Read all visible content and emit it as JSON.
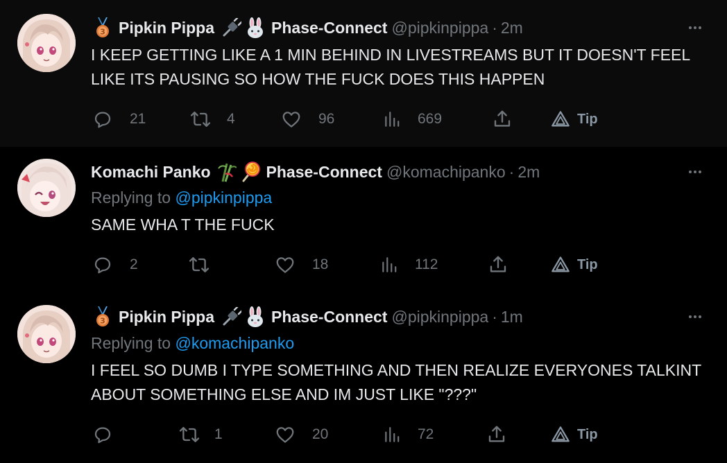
{
  "tweets": [
    {
      "name": "Pipkin Pippa",
      "affiliation": "Phase-Connect",
      "handle": "@pipkinpippa",
      "dot": "·",
      "time": "2m",
      "replying_label": "",
      "replying_to": "",
      "text": "I KEEP GETTING LIKE A 1 MIN BEHIND IN LIVESTREAMS BUT IT DOESN'T FEEL LIKE ITS PAUSING SO HOW THE FUCK DOES THIS HAPPEN",
      "replies": "21",
      "retweets": "4",
      "likes": "96",
      "views": "669",
      "tip": "Tip",
      "badge_icons": [
        "medal-icon",
        "plug-icon",
        "rabbit-icon"
      ]
    },
    {
      "name": "Komachi Panko",
      "affiliation": "Phase-Connect",
      "handle": "@komachipanko",
      "dot": "·",
      "time": "2m",
      "replying_label": "Replying to",
      "replying_to": "@pipkinpippa",
      "text": "SAME WHA T THE FUCK",
      "replies": "2",
      "retweets": "",
      "likes": "18",
      "views": "112",
      "tip": "Tip",
      "badge_icons": [
        "bamboo-icon",
        "lollipop-icon"
      ]
    },
    {
      "name": "Pipkin Pippa",
      "affiliation": "Phase-Connect",
      "handle": "@pipkinpippa",
      "dot": "·",
      "time": "1m",
      "replying_label": "Replying to",
      "replying_to": "@komachipanko",
      "text": "I FEEL SO DUMB I TYPE SOMETHING AND THEN REALIZE EVERYONES TALKINT ABOUT SOMETHING ELSE AND IM JUST LIKE \"???\"",
      "replies": "",
      "retweets": "1",
      "likes": "20",
      "views": "72",
      "tip": "Tip",
      "badge_icons": [
        "medal-icon",
        "plug-icon",
        "rabbit-icon"
      ]
    }
  ],
  "colors": {
    "background": "#000000",
    "text": "#e7e9ea",
    "muted": "#71767b",
    "link": "#1d9bf0",
    "thread_line": "#333639"
  }
}
